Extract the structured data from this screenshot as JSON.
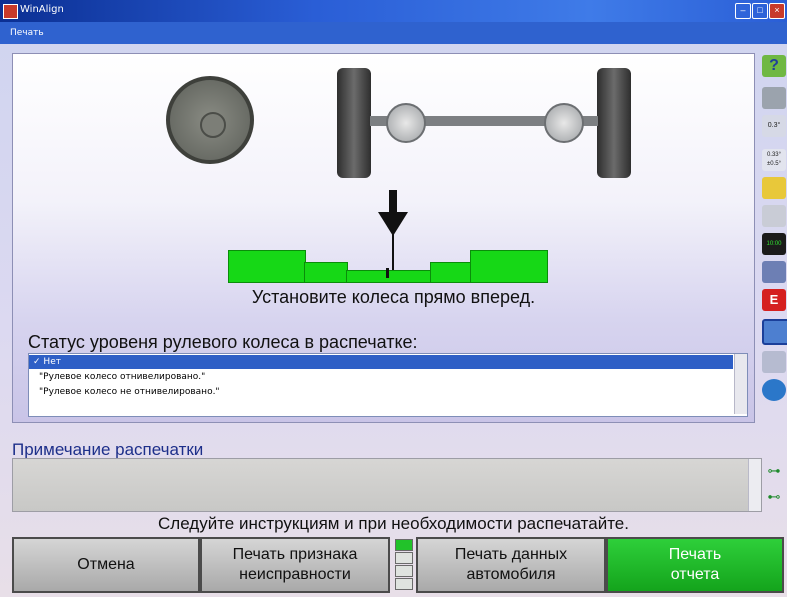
{
  "window": {
    "title": "WinAlign",
    "minimize": "–",
    "maximize": "□",
    "close": "×"
  },
  "menu": {
    "items": [
      "Печать"
    ]
  },
  "main": {
    "instruction": "Установите колеса прямо вперед.",
    "status_heading": "Статус уровеня рулевого колеса в распечатке:",
    "list": {
      "items": [
        {
          "label": "Нет",
          "selected": true
        },
        {
          "label": "\"Рулевое колесо отнивелировано.\"",
          "selected": false
        },
        {
          "label": "\"Рулевое колесо не отнивелировано.\"",
          "selected": false
        }
      ],
      "checkmark": "✓"
    },
    "indicator_colors": {
      "bar": "#16d816",
      "border": "#0a8d0a"
    }
  },
  "right_toolbar": {
    "icons": [
      {
        "name": "help-icon",
        "label": "?"
      },
      {
        "name": "printer-icon",
        "label": ""
      },
      {
        "name": "measure-icon",
        "label": "0.3°"
      },
      {
        "name": "spec-values-icon",
        "label": "0.33° ±0.5°"
      },
      {
        "name": "wrench-icon",
        "label": ""
      },
      {
        "name": "sensor-icon",
        "label": ""
      },
      {
        "name": "timer-icon",
        "label": "10:00"
      },
      {
        "name": "vehicle-icon",
        "label": ""
      },
      {
        "name": "race-flag-icon",
        "label": "E"
      },
      {
        "name": "report-icon",
        "label": ""
      },
      {
        "name": "transfer-icon",
        "label": ""
      },
      {
        "name": "globe-icon",
        "label": ""
      }
    ]
  },
  "notes": {
    "label": "Примечание распечатки"
  },
  "footer": {
    "instruction": "Следуйте инструкциям и при необходимости распечатайте.",
    "buttons": {
      "cancel": "Отмена",
      "print_fault_line1": "Печать признака",
      "print_fault_line2": "неисправности",
      "print_vehicle_line1": "Печать данных",
      "print_vehicle_line2": "автомобиля",
      "print_report_line1": "Печать",
      "print_report_line2": "отчета"
    }
  }
}
